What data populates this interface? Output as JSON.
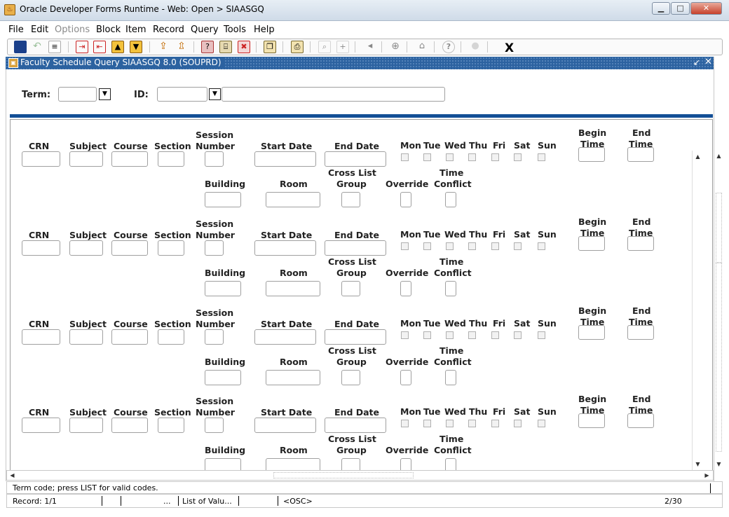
{
  "window": {
    "title": "Oracle Developer Forms Runtime - Web:  Open > SIAASGQ",
    "min": "▁",
    "max": "□",
    "close": "✕"
  },
  "menu": [
    "File",
    "Edit",
    "Options",
    "Block",
    "Item",
    "Record",
    "Query",
    "Tools",
    "Help"
  ],
  "toolbar": {
    "exit": "X",
    "icons": [
      "save-icon",
      "rollback-icon",
      "print-preview-icon",
      "insert-record-icon",
      "remove-record-icon",
      "previous-record-icon",
      "next-record-icon",
      "enter-query-icon",
      "execute-query-icon",
      "cancel-query-icon",
      "exit-icon",
      "clear-form-icon",
      "item-properties-icon",
      "print-icon",
      "zoom-in-icon",
      "zoom-out-icon",
      "search-icon",
      "grid-icon",
      "home-icon",
      "help-icon",
      "lightbulb-icon"
    ]
  },
  "form": {
    "title": "Faculty Schedule Query  SIAASGQ  8.0  (SOUPRD)",
    "min": "↙",
    "close": "✕"
  },
  "key": {
    "term_label": "Term:",
    "id_label": "ID:",
    "term_value": "",
    "id_value": "",
    "name_value": ""
  },
  "detail": {
    "headers": {
      "crn": "CRN",
      "subject": "Subject",
      "course": "Course",
      "section": "Section",
      "session1": "Session",
      "session2": "Number",
      "start": "Start Date",
      "end": "End Date",
      "mon": "Mon",
      "tue": "Tue",
      "wed": "Wed",
      "thu": "Thu",
      "fri": "Fri",
      "sat": "Sat",
      "sun": "Sun",
      "begin1": "Begin",
      "begin2": "Time",
      "endt1": "End",
      "endt2": "Time",
      "building": "Building",
      "room": "Room",
      "cross1": "Cross List",
      "cross2": "Group",
      "override": "Override",
      "conflict1": "Time",
      "conflict2": "Conflict"
    },
    "records": [
      {
        "crn": ""
      },
      {
        "crn": ""
      },
      {
        "crn": ""
      },
      {
        "crn": ""
      }
    ]
  },
  "status": {
    "message": "Term code; press LIST for valid codes.",
    "record": "Record: 1/1",
    "ellipsis": "...",
    "lov": "List of Valu...",
    "osc": "<OSC>",
    "count": "2/30"
  }
}
